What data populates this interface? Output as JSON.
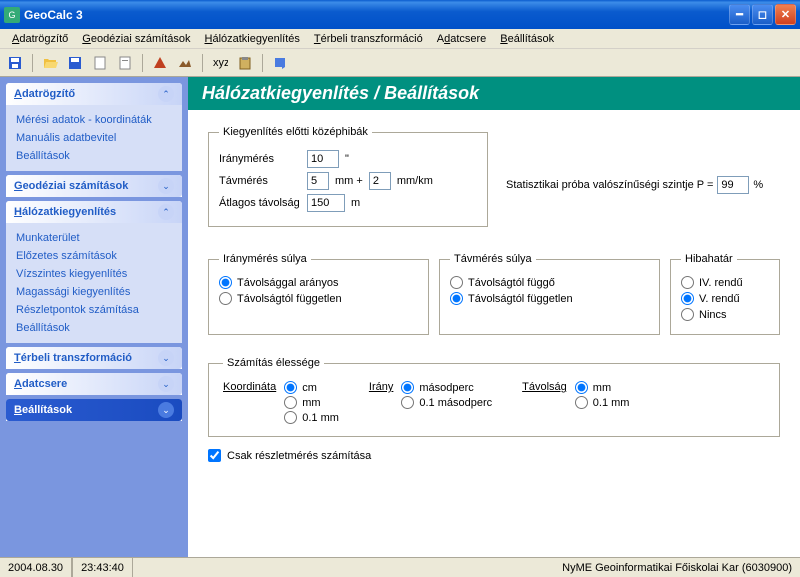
{
  "window": {
    "title": "GeoCalc 3"
  },
  "menu": {
    "adatrogzito": "Adatrögzítő",
    "geodeziai": "Geodéziai számítások",
    "halozat": "Hálózatkiegyenlítés",
    "terbeli": "Térbeli transzformáció",
    "adatcsere": "Adatcsere",
    "beallitasok": "Beállítások"
  },
  "sidebar": {
    "adatrogzito": {
      "title": "Adatrögzítő",
      "items": [
        "Mérési adatok - koordináták",
        "Manuális adatbevitel",
        "Beállítások"
      ]
    },
    "geodeziai": {
      "title": "Geodéziai számítások"
    },
    "halozat": {
      "title": "Hálózatkiegyenlítés",
      "items": [
        "Munkaterület",
        "Előzetes számítások",
        "Vízszintes kiegyenlítés",
        "Magassági kiegyenlítés",
        "Részletpontok számítása",
        "Beállítások"
      ]
    },
    "terbeli": {
      "title": "Térbeli transzformáció"
    },
    "adatcsere": {
      "title": "Adatcsere"
    },
    "beallitasok": {
      "title": "Beállítások"
    }
  },
  "page": {
    "title": "Hálózatkiegyenlítés / Beállítások",
    "kozephibak": {
      "legend": "Kiegyenlítés előtti középhibák",
      "iranymeres_label": "Iránymérés",
      "iranymeres_value": "10",
      "iranymeres_unit": "\"",
      "tavmeres_label": "Távmérés",
      "tavmeres_a": "5",
      "tavmeres_mm": "mm +",
      "tavmeres_b": "2",
      "tavmeres_mmkm": "mm/km",
      "atlagos_label": "Átlagos távolság",
      "atlagos_value": "150",
      "atlagos_unit": "m"
    },
    "prob": {
      "label": "Statisztikai próba valószínűségi szintje  P =",
      "value": "99",
      "unit": "%"
    },
    "iranysuly": {
      "legend": "Iránymérés súlya",
      "opt1": "Távolsággal arányos",
      "opt2": "Távolságtól független"
    },
    "tavsuly": {
      "legend": "Távmérés súlya",
      "opt1": "Távolságtól függő",
      "opt2": "Távolságtól független"
    },
    "hibahatar": {
      "legend": "Hibahatár",
      "opt1": "IV. rendű",
      "opt2": "V. rendű",
      "opt3": "Nincs"
    },
    "elesseg": {
      "legend": "Számítás élessége",
      "koordinata": {
        "label": "Koordináta",
        "o1": "cm",
        "o2": "mm",
        "o3": "0.1 mm"
      },
      "irany": {
        "label": "Irány",
        "o1": "másodperc",
        "o2": "0.1 másodperc"
      },
      "tavolsag": {
        "label": "Távolság",
        "o1": "mm",
        "o2": "0.1 mm"
      }
    },
    "csak_reszlet": "Csak részletmérés számítása"
  },
  "statusbar": {
    "date": "2004.08.30",
    "time": "23:43:40",
    "org": "NyME Geoinformatikai Főiskolai Kar (6030900)"
  }
}
